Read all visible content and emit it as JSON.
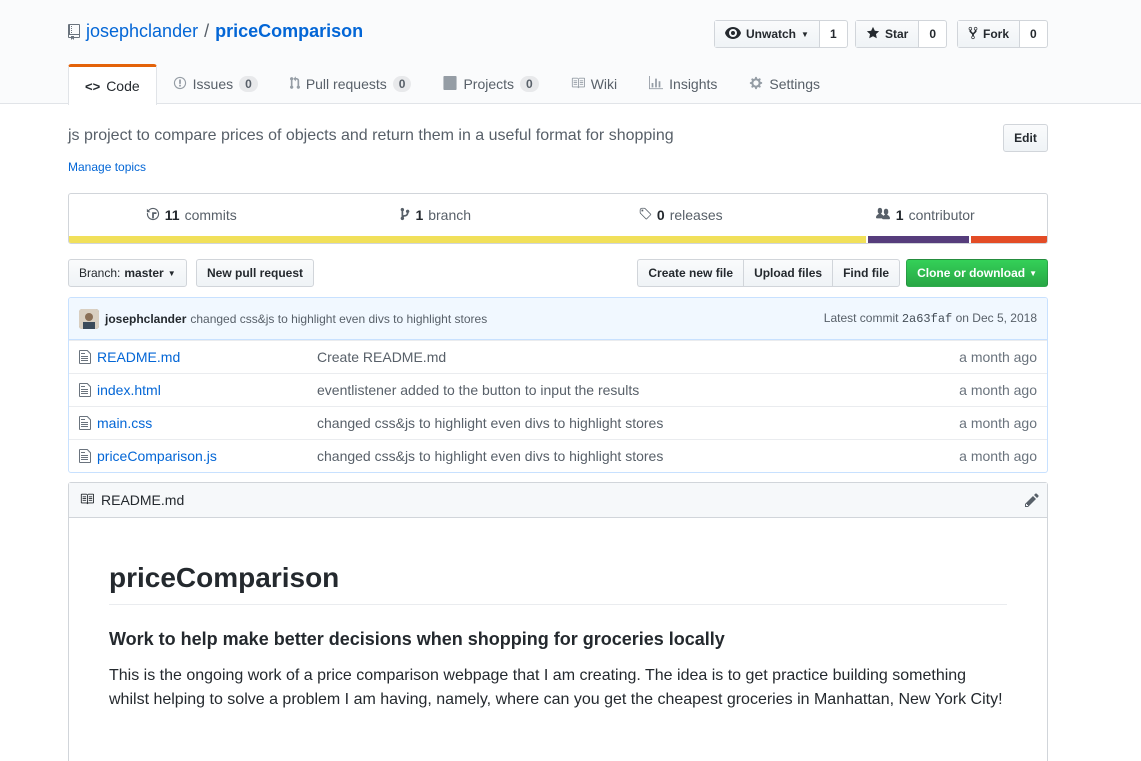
{
  "repo": {
    "owner": "josephclander",
    "separator": "/",
    "name": "priceComparison"
  },
  "actions": {
    "watch": {
      "label": "Unwatch",
      "count": "1"
    },
    "star": {
      "label": "Star",
      "count": "0"
    },
    "fork": {
      "label": "Fork",
      "count": "0"
    }
  },
  "tabs": [
    {
      "label": "Code"
    },
    {
      "label": "Issues",
      "count": "0"
    },
    {
      "label": "Pull requests",
      "count": "0"
    },
    {
      "label": "Projects",
      "count": "0"
    },
    {
      "label": "Wiki"
    },
    {
      "label": "Insights"
    },
    {
      "label": "Settings"
    }
  ],
  "description": "js project to compare prices of objects and return them in a useful format for shopping",
  "manage_topics": "Manage topics",
  "edit_label": "Edit",
  "summary": {
    "commits": {
      "count": "11",
      "label": "commits"
    },
    "branches": {
      "count": "1",
      "label": "branch"
    },
    "releases": {
      "count": "0",
      "label": "releases"
    },
    "contributors": {
      "count": "1",
      "label": "contributor"
    }
  },
  "languages": [
    {
      "color": "#f1e05a",
      "percent": 81.5
    },
    {
      "color": "#563d7c",
      "percent": 10.5
    },
    {
      "color": "#e34c26",
      "percent": 8.0
    }
  ],
  "filebar": {
    "branch_prefix": "Branch:",
    "branch": "master",
    "new_pr": "New pull request",
    "create_file": "Create new file",
    "upload_files": "Upload files",
    "find_file": "Find file",
    "clone": "Clone or download"
  },
  "commit": {
    "author": "josephclander",
    "message": "changed css&js to highlight even divs to highlight stores",
    "latest_label": "Latest commit",
    "sha": "2a63faf",
    "date_text": "on Dec 5, 2018"
  },
  "files": [
    {
      "name": "README.md",
      "message": "Create README.md",
      "age": "a month ago"
    },
    {
      "name": "index.html",
      "message": "eventlistener added to the button to input the results",
      "age": "a month ago"
    },
    {
      "name": "main.css",
      "message": "changed css&js to highlight even divs to highlight stores",
      "age": "a month ago"
    },
    {
      "name": "priceComparison.js",
      "message": "changed css&js to highlight even divs to highlight stores",
      "age": "a month ago"
    }
  ],
  "readme": {
    "filename": "README.md",
    "h1": "priceComparison",
    "h3": "Work to help make better decisions when shopping for groceries locally",
    "paragraph": "This is the ongoing work of a price comparison webpage that I am creating. The idea is to get practice building something whilst helping to solve a problem I am having, namely, where can you get the cheapest groceries in Manhattan, New York City!"
  }
}
